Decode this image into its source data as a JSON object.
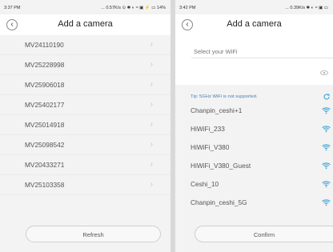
{
  "left": {
    "status": {
      "time": "3:37 PM",
      "icons": "... 0.57K/s ⊙ ✱ ◐ ≈ ▣ ⚡ ▭ 14%"
    },
    "title": "Add a camera",
    "cameras": [
      "MV24110190",
      "MV25228998",
      "MV25906018",
      "MV25402177",
      "MV25014918",
      "MV25098542",
      "MV20433271",
      "MV25103358"
    ],
    "refresh_label": "Refresh"
  },
  "right": {
    "status": {
      "time": "3:42 PM",
      "icons": "... 0.39K/s ✱ ◐ ≈ ▣ ▭"
    },
    "title": "Add a camera",
    "wifi_placeholder": "Select your WiFi",
    "tip": "Tip: 5GHz WiFi is not supported.",
    "networks": [
      "Chanpin_ceshi+1",
      "HiWiFi_233",
      "HiWiFi_V380",
      "HiWiFi_V380_Guest",
      "Ceshi_10",
      "Chanpin_ceshi_5G"
    ],
    "confirm_label": "Confirm"
  },
  "colors": {
    "accent": "#4a7fb5",
    "background": "#f3f3f3"
  }
}
